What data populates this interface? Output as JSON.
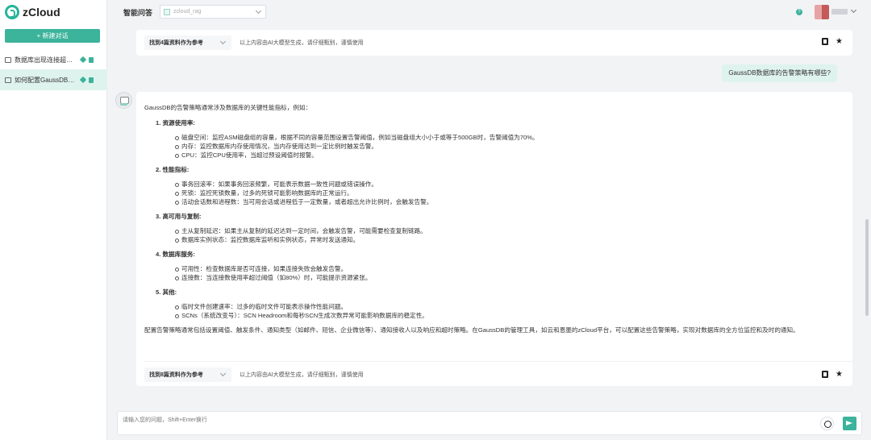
{
  "app": {
    "name": "zCloud"
  },
  "sidebar": {
    "new_chat_label": "+ 新建对话",
    "conversations": [
      {
        "title": "数据库出现连接超时怎么办"
      },
      {
        "title": "如何配置GaussDB数据库告警策略"
      }
    ]
  },
  "header": {
    "title": "智能问答",
    "kb_value": "zcloud_rag",
    "help_icon": "help-icon"
  },
  "chat": {
    "top_ref": {
      "label": "找到4篇资料作为参考",
      "note": "以上内容由AI大模型生成，请仔细甄别，谨慎使用"
    },
    "user_question": "GaussDB数据库的告警策略有哪些?",
    "answer": {
      "intro": "GaussDB的告警策略通常涉及数据库的关键性能指标，例如：",
      "sections": [
        {
          "title": "1. 资源使用率:",
          "items": [
            "磁盘空间：监控ASM磁盘组的容量，根据不同的容量范围设置告警阈值，例如当磁盘组大小小于或等于500GB时，告警阈值为70%。",
            "内存：监控数据库内存使用情况，当内存使用达到一定比例时触发告警。",
            "CPU：监控CPU使用率，当超过预设阈值时报警。"
          ]
        },
        {
          "title": "2. 性能指标:",
          "items": [
            "事务回滚率：如果事务回滚频繁，可能表示数据一致性问题或错误操作。",
            "死锁：监控死锁数量，过多的死锁可能影响数据库的正常运行。",
            "活动会话数和进程数：当可用会话或进程低于一定数量，或者超出允许比例时，会触发告警。"
          ]
        },
        {
          "title": "3. 高可用与复制:",
          "items": [
            "主从复制延迟：如果主从复制的延迟达到一定时间，会触发告警，可能需要检查复制链路。",
            "数据库实例状态：监控数据库监听和实例状态，异常时发送通知。"
          ]
        },
        {
          "title": "4. 数据库服务:",
          "items": [
            "可用性：检查数据库是否可连接，如果连接失败会触发告警。",
            "连接数：当连接数使用率超过阈值（如80%）时，可能提示资源紧张。"
          ]
        },
        {
          "title": "5. 其他:",
          "items": [
            "临时文件创建速率：过多的临时文件可能表示操作性能问题。",
            "SCNs（系统改变号）：SCN Headroom和每秒SCN生成次数异常可能影响数据库的稳定性。"
          ]
        }
      ],
      "conclusion": "配置告警策略通常包括设置阈值、触发条件、通知类型（如邮件、短信、企业微信等）、通知接收人以及响应和超时策略。在GaussDB的管理工具，如云和恩墨的zCloud平台，可以配置这些告警策略，实现对数据库的全方位监控和及时的通知。",
      "ref": {
        "label": "找到8篇资料作为参考",
        "note": "以上内容由AI大模型生成，请仔细甄别，谨慎使用"
      }
    }
  },
  "composer": {
    "placeholder": "请输入您的问题，Shift+Enter换行"
  },
  "colors": {
    "accent": "#3cb39b",
    "bubble": "#dff3ee"
  }
}
